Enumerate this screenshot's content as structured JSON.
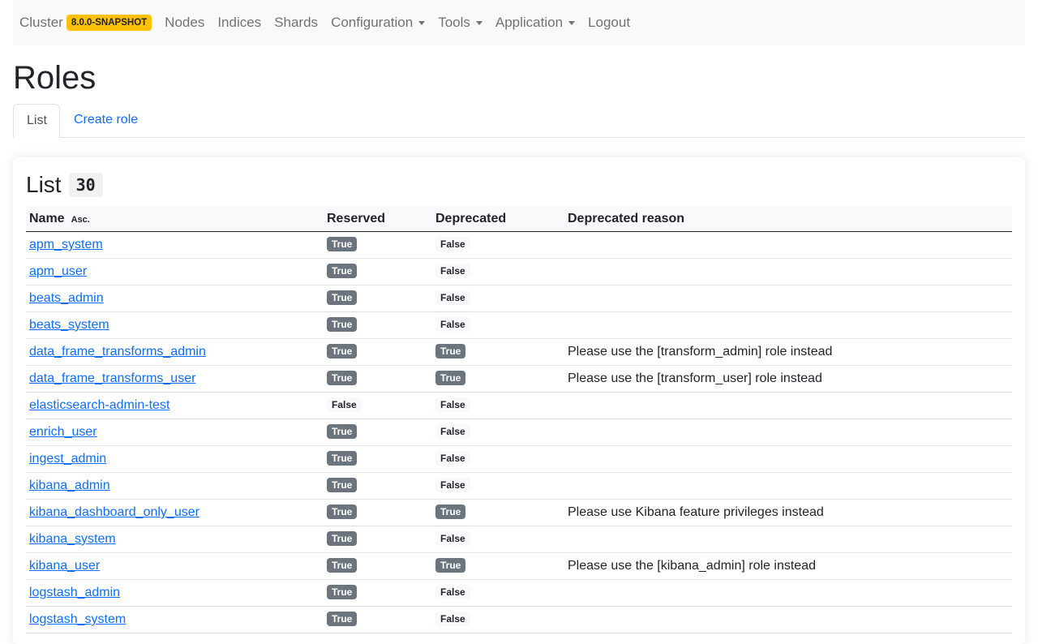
{
  "navbar": {
    "brand": "Cluster",
    "version": "8.0.0-SNAPSHOT",
    "items": [
      {
        "label": "Nodes"
      },
      {
        "label": "Indices"
      },
      {
        "label": "Shards"
      },
      {
        "label": "Configuration"
      },
      {
        "label": "Tools"
      },
      {
        "label": "Application"
      },
      {
        "label": "Logout"
      }
    ]
  },
  "page": {
    "title": "Roles"
  },
  "tabs": [
    {
      "label": "List",
      "active": true
    },
    {
      "label": "Create role",
      "active": false
    }
  ],
  "list": {
    "title": "List",
    "count": "30",
    "columns": {
      "name": "Name",
      "sort": "Asc.",
      "reserved": "Reserved",
      "deprecated": "Deprecated",
      "reason": "Deprecated reason"
    },
    "rows": [
      {
        "name": "apm_system",
        "reserved": "True",
        "deprecated": "False",
        "reason": ""
      },
      {
        "name": "apm_user",
        "reserved": "True",
        "deprecated": "False",
        "reason": ""
      },
      {
        "name": "beats_admin",
        "reserved": "True",
        "deprecated": "False",
        "reason": ""
      },
      {
        "name": "beats_system",
        "reserved": "True",
        "deprecated": "False",
        "reason": ""
      },
      {
        "name": "data_frame_transforms_admin",
        "reserved": "True",
        "deprecated": "True",
        "reason": "Please use the [transform_admin] role instead"
      },
      {
        "name": "data_frame_transforms_user",
        "reserved": "True",
        "deprecated": "True",
        "reason": "Please use the [transform_user] role instead"
      },
      {
        "name": "elasticsearch-admin-test",
        "reserved": "False",
        "deprecated": "False",
        "reason": ""
      },
      {
        "name": "enrich_user",
        "reserved": "True",
        "deprecated": "False",
        "reason": ""
      },
      {
        "name": "ingest_admin",
        "reserved": "True",
        "deprecated": "False",
        "reason": ""
      },
      {
        "name": "kibana_admin",
        "reserved": "True",
        "deprecated": "False",
        "reason": ""
      },
      {
        "name": "kibana_dashboard_only_user",
        "reserved": "True",
        "deprecated": "True",
        "reason": "Please use Kibana feature privileges instead"
      },
      {
        "name": "kibana_system",
        "reserved": "True",
        "deprecated": "False",
        "reason": ""
      },
      {
        "name": "kibana_user",
        "reserved": "True",
        "deprecated": "True",
        "reason": "Please use the [kibana_admin] role instead"
      },
      {
        "name": "logstash_admin",
        "reserved": "True",
        "deprecated": "False",
        "reason": ""
      },
      {
        "name": "logstash_system",
        "reserved": "True",
        "deprecated": "False",
        "reason": ""
      }
    ]
  }
}
